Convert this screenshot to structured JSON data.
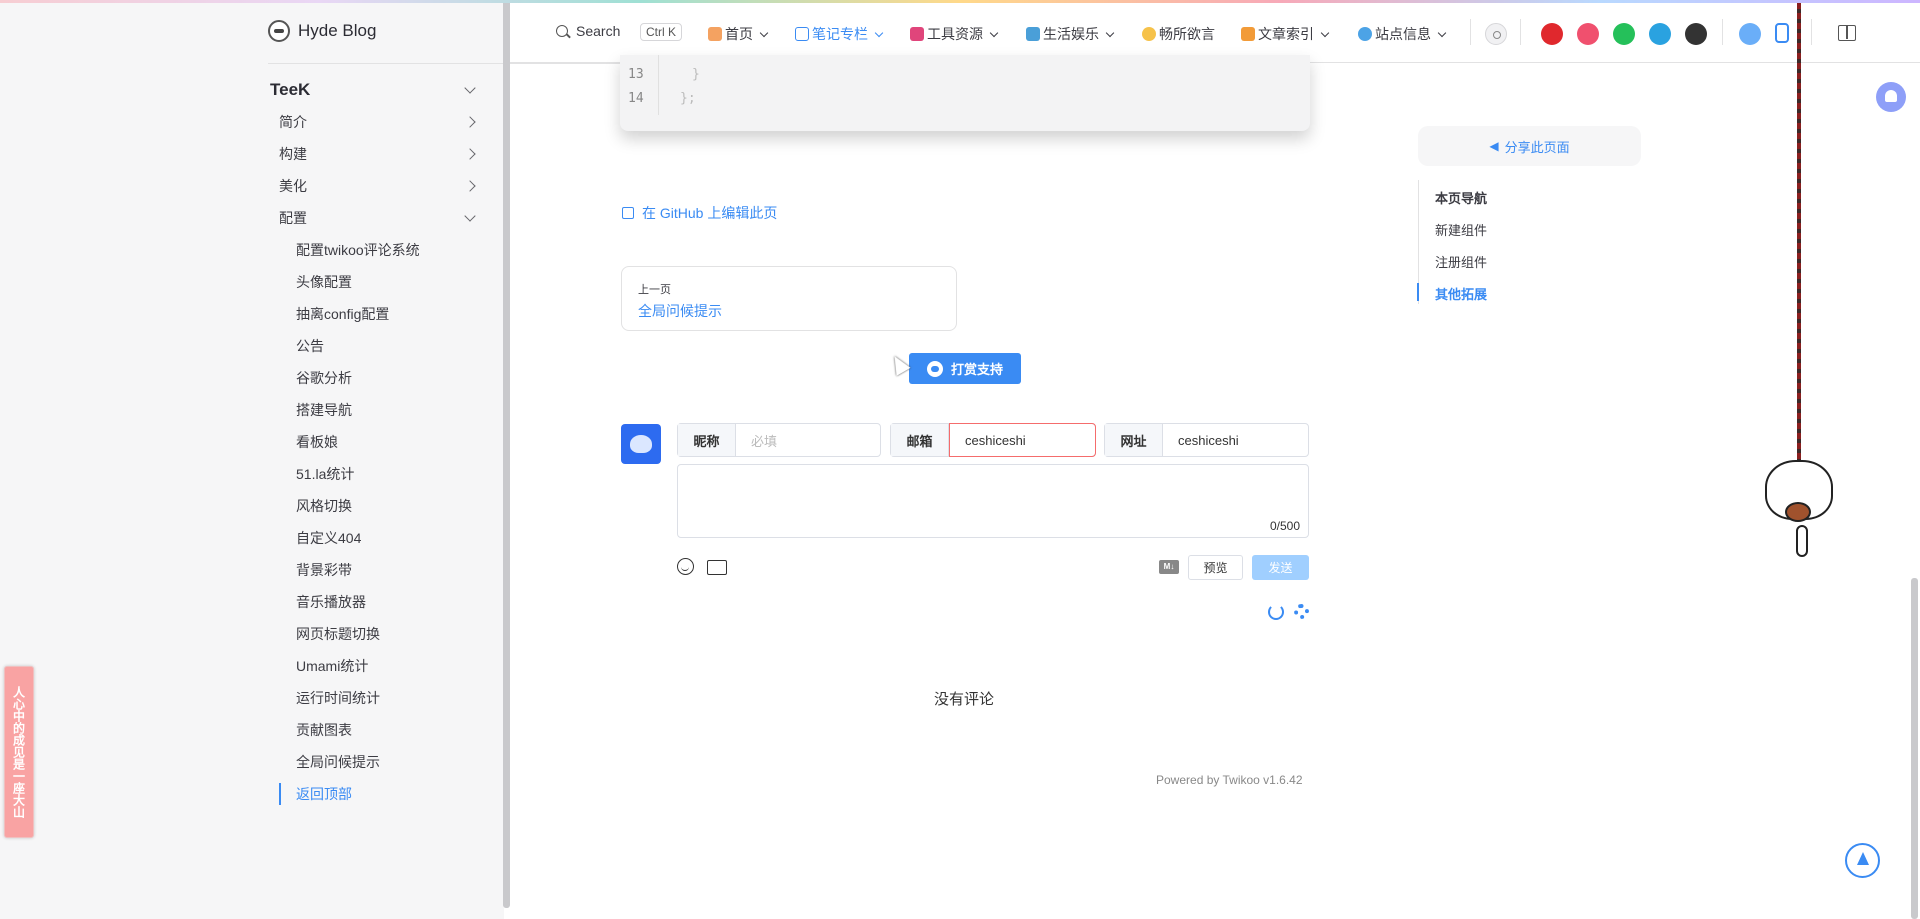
{
  "site": {
    "title": "Hyde Blog"
  },
  "nav": {
    "search_label": "Search",
    "search_shortcut": "Ctrl K",
    "items": [
      {
        "label": "首页",
        "icon": "house-icon",
        "has_dropdown": true
      },
      {
        "label": "笔记专栏",
        "icon": "book-icon",
        "has_dropdown": true,
        "active": true
      },
      {
        "label": "工具资源",
        "icon": "toolbox-icon",
        "has_dropdown": true
      },
      {
        "label": "生活娱乐",
        "icon": "picture-icon",
        "has_dropdown": true
      },
      {
        "label": "畅所欲言",
        "icon": "hand-icon",
        "has_dropdown": false
      },
      {
        "label": "文章索引",
        "icon": "tag-icon",
        "has_dropdown": true
      },
      {
        "label": "站点信息",
        "icon": "globe-icon",
        "has_dropdown": true
      }
    ],
    "social": [
      {
        "icon": "gitee-icon",
        "color": "#e0282d"
      },
      {
        "icon": "mail-icon",
        "color": "#f0506e"
      },
      {
        "icon": "whatsapp-icon",
        "color": "#25c05a"
      },
      {
        "icon": "telegram-icon",
        "color": "#2aa2e0"
      },
      {
        "icon": "github-icon",
        "color": "#333333"
      },
      {
        "icon": "bilibili-icon",
        "color": "#6aaef8"
      },
      {
        "icon": "music-note-icon",
        "color": "#3a8bf3"
      }
    ]
  },
  "sidebar": {
    "group": "TeeK",
    "sections": [
      {
        "label": "简介",
        "expanded": false
      },
      {
        "label": "构建",
        "expanded": false
      },
      {
        "label": "美化",
        "expanded": false
      },
      {
        "label": "配置",
        "expanded": true
      }
    ],
    "config_items": [
      "配置twikoo评论系统",
      "头像配置",
      "抽离config配置",
      "公告",
      "谷歌分析",
      "搭建导航",
      "看板娘",
      "51.la统计",
      "风格切换",
      "自定义404",
      "背景彩带",
      "音乐播放器",
      "网页标题切换",
      "Umami统计",
      "运行时间统计",
      "贡献图表",
      "全局问候提示",
      "返回顶部"
    ],
    "active_item": "返回顶部"
  },
  "code": {
    "lines": [
      "13",
      "14"
    ],
    "text": [
      "}",
      "};"
    ]
  },
  "content": {
    "edit_link": "在 GitHub 上编辑此页",
    "prev": {
      "desc": "上一页",
      "title": "全局问候提示"
    },
    "reward_button": "打赏支持"
  },
  "twikoo": {
    "nick": {
      "label": "昵称",
      "placeholder": "必填",
      "value": ""
    },
    "mail": {
      "label": "邮箱",
      "value": "ceshiceshi"
    },
    "link": {
      "label": "网址",
      "value": "ceshiceshi"
    },
    "counter": "0/500",
    "md_badge": "M↓",
    "preview_button": "预览",
    "send_button": "发送",
    "empty": "没有评论",
    "powered": "Powered by Twikoo v1.6.42"
  },
  "aside": {
    "share": "分享此页面",
    "outline_title": "本页导航",
    "outline": [
      "新建组件",
      "注册组件",
      "其他拓展"
    ],
    "active_outline": "其他拓展"
  },
  "decor": {
    "poem": "人心中的成见是一座大山"
  }
}
